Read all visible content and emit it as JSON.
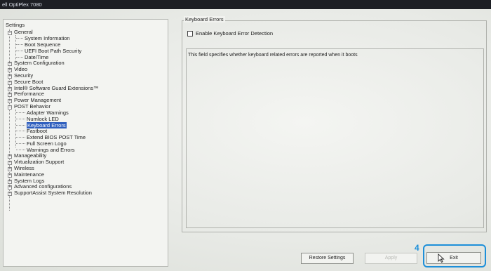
{
  "window": {
    "title": "ell OptiPlex 7080"
  },
  "tree": {
    "root_label": "Settings",
    "items": [
      {
        "label": "General",
        "expander": "−"
      },
      {
        "label": "System Information"
      },
      {
        "label": "Boot Sequence"
      },
      {
        "label": "UEFI Boot Path Security"
      },
      {
        "label": "Date/Time"
      },
      {
        "label": "System Configuration",
        "expander": "+"
      },
      {
        "label": "Video",
        "expander": "+"
      },
      {
        "label": "Security",
        "expander": "+"
      },
      {
        "label": "Secure Boot",
        "expander": "+"
      },
      {
        "label": "Intel® Software Guard Extensions™",
        "expander": "+"
      },
      {
        "label": "Performance",
        "expander": "+"
      },
      {
        "label": "Power Management",
        "expander": "+"
      },
      {
        "label": "POST Behavior",
        "expander": "−"
      },
      {
        "label": "Adapter Warnings"
      },
      {
        "label": "Numlock LED"
      },
      {
        "label": "Keyboard Errors",
        "selected": true
      },
      {
        "label": "Fastboot"
      },
      {
        "label": "Extend BIOS POST Time"
      },
      {
        "label": "Full Screen Logo"
      },
      {
        "label": "Warnings and Errors"
      },
      {
        "label": "Manageability",
        "expander": "+"
      },
      {
        "label": "Virtualization Support",
        "expander": "+"
      },
      {
        "label": "Wireless",
        "expander": "+"
      },
      {
        "label": "Maintenance",
        "expander": "+"
      },
      {
        "label": "System Logs",
        "expander": "+"
      },
      {
        "label": "Advanced configurations",
        "expander": "+"
      },
      {
        "label": "SupportAssist System Resolution",
        "expander": "+"
      }
    ]
  },
  "detail": {
    "group_title": "Keyboard Errors",
    "checkbox_label": "Enable Keyboard Error Detection",
    "checkbox_checked": false,
    "description": "This field specifies whether keyboard related errors are reported when it boots"
  },
  "buttons": {
    "restore": "Restore Settings",
    "apply": "Apply",
    "exit": "Exit"
  },
  "annotation": {
    "step": "4"
  },
  "colors": {
    "selection": "#2f5fbe",
    "annotation": "#1d8fd9"
  }
}
